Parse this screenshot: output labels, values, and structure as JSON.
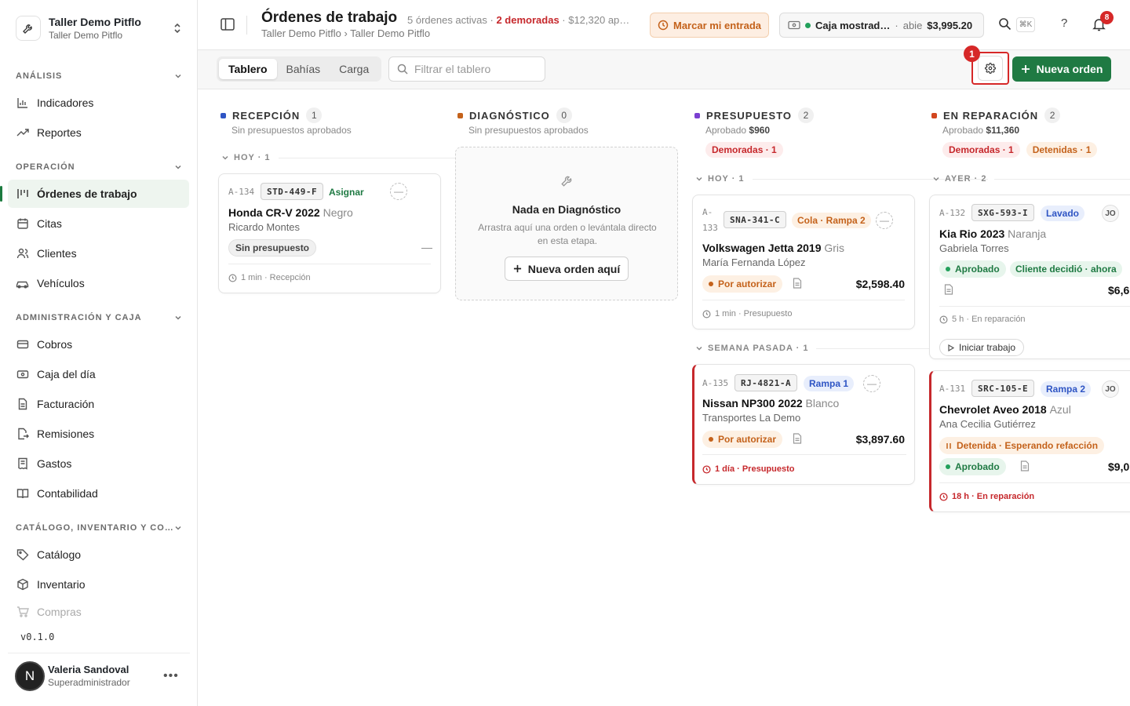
{
  "workspace": {
    "name": "Taller Demo Pitflo",
    "sub": "Taller Demo Pitflo"
  },
  "sidebar": {
    "sections": [
      {
        "label": "ANÁLISIS",
        "items": [
          {
            "label": "Indicadores"
          },
          {
            "label": "Reportes"
          }
        ]
      },
      {
        "label": "OPERACIÓN",
        "items": [
          {
            "label": "Órdenes de trabajo"
          },
          {
            "label": "Citas"
          },
          {
            "label": "Clientes"
          },
          {
            "label": "Vehículos"
          }
        ]
      },
      {
        "label": "ADMINISTRACIÓN Y CAJA",
        "items": [
          {
            "label": "Cobros"
          },
          {
            "label": "Caja del día"
          },
          {
            "label": "Facturación"
          },
          {
            "label": "Remisiones"
          },
          {
            "label": "Gastos"
          },
          {
            "label": "Contabilidad"
          }
        ]
      },
      {
        "label": "CATÁLOGO, INVENTARIO Y CO…",
        "items": [
          {
            "label": "Catálogo"
          },
          {
            "label": "Inventario"
          },
          {
            "label": "Compras"
          }
        ]
      }
    ],
    "version": "v0.1.0",
    "user": {
      "initial": "N",
      "name": "Valeria Sandoval",
      "role": "Superadministrador"
    }
  },
  "header": {
    "title": "Órdenes de trabajo",
    "meta_active": "5 órdenes activas",
    "meta_sep": " · ",
    "meta_late": "2 demoradas",
    "meta_amount": " · $12,320 ap…",
    "breadcrumb": "Taller Demo Pitflo › Taller Demo Pitflo",
    "entrada_label": "Marcar mi entrada",
    "caja_name": "Caja mostrad…",
    "caja_sep": "·",
    "caja_status": "abie",
    "caja_amount": "$3,995.20",
    "shortcut": "⌘K",
    "help": "?",
    "notifications": "8"
  },
  "toolbar": {
    "tabs": [
      {
        "label": "Tablero"
      },
      {
        "label": "Bahías"
      },
      {
        "label": "Carga"
      }
    ],
    "filter_placeholder": "Filtrar el tablero",
    "step_badge": "1",
    "new_order_label": "Nueva orden"
  },
  "colors": {
    "accent": "#1f7a43",
    "danger": "#d62828",
    "reception": "#2f55c4",
    "diagnosis": "#c4621b",
    "budget": "#7b3fd1",
    "repair": "#d2461e"
  },
  "columns": {
    "reception": {
      "title": "RECEPCIÓN",
      "count": "1",
      "sub": "Sin presupuestos aprobados",
      "group": "HOY · 1",
      "card": {
        "code": "A-134",
        "plate": "STD-449-F",
        "assign": "Asignar",
        "vehicle": "Honda CR-V 2022",
        "color": "Negro",
        "owner": "Ricardo Montes",
        "status": "Sin presupuesto",
        "dash": "—",
        "time": "1 min · Recepción"
      }
    },
    "diagnosis": {
      "title": "DIAGNÓSTICO",
      "count": "0",
      "sub": "Sin presupuestos aprobados",
      "empty_title": "Nada en Diagnóstico",
      "empty_desc": "Arrastra aquí una orden o levántala directo en esta etapa.",
      "empty_btn": "Nueva orden aquí"
    },
    "budget": {
      "title": "PRESUPUESTO",
      "count": "2",
      "sub_label": "Aprobado",
      "sub_value": "$960",
      "pill_late": "Demoradas · 1",
      "groups": [
        "HOY · 1",
        "SEMANA PASADA · 1"
      ],
      "cards": [
        {
          "code_a": "A-",
          "code_b": "133",
          "plate": "SNA-341-C",
          "tag": "Cola · Rampa 2",
          "vehicle": "Volkswagen Jetta 2019",
          "color": "Gris",
          "owner": "María Fernanda López",
          "status": "Por autorizar",
          "price": "$2,598.40",
          "time": "1 min · Presupuesto"
        },
        {
          "code": "A-135",
          "plate": "RJ-4821-A",
          "tag": "Rampa 1",
          "vehicle": "Nissan NP300 2022",
          "color": "Blanco",
          "owner": "Transportes La Demo",
          "status": "Por autorizar",
          "price": "$3,897.60",
          "time": "1 día · Presupuesto"
        }
      ]
    },
    "repair": {
      "title": "EN REPARACIÓN",
      "count": "2",
      "sub_label": "Aprobado",
      "sub_value": "$11,360",
      "pill_late": "Demoradas · 1",
      "pill_hold": "Detenidas · 1",
      "group": "AYER · 2",
      "cards": [
        {
          "code": "A-132",
          "plate": "SXG-593-I",
          "tag": "Lavado",
          "initials": "JO",
          "vehicle": "Kia Rio 2023",
          "color": "Naranja",
          "owner": "Gabriela Torres",
          "status": "Aprobado",
          "decision": "Cliente decidió · ahora",
          "price": "$6,6",
          "time": "5 h · En reparación",
          "action": "Iniciar trabajo"
        },
        {
          "code": "A-131",
          "plate": "SRC-105-E",
          "tag": "Rampa 2",
          "initials": "JO",
          "vehicle": "Chevrolet Aveo 2018",
          "color": "Azul",
          "owner": "Ana Cecilia Gutiérrez",
          "hold": "Detenida · Esperando refacción",
          "status": "Aprobado",
          "price": "$9,0",
          "time": "18 h · En reparación"
        }
      ]
    }
  }
}
